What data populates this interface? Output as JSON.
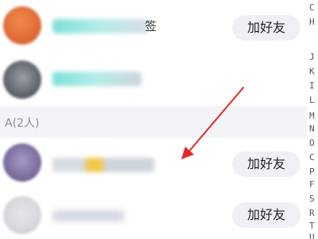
{
  "contacts": {
    "rows": [
      {
        "add_label": "加好友"
      },
      {
        "add_label": ""
      },
      {
        "add_label": "加好友"
      },
      {
        "add_label": "加好友"
      }
    ],
    "section_header": "A(2人)",
    "row0_trailing_char": "签"
  },
  "index_bar": [
    "C",
    "H",
    "J",
    "K",
    "I",
    "L",
    "M",
    "N",
    "O",
    "C",
    "P",
    "F",
    "S",
    "R",
    "T",
    "U"
  ],
  "colors": {
    "arrow": "#e02a2a",
    "button_bg": "#eef0f5",
    "section_bg": "#f3f4f7"
  },
  "icons": {
    "annotation": "red-arrow-icon"
  }
}
